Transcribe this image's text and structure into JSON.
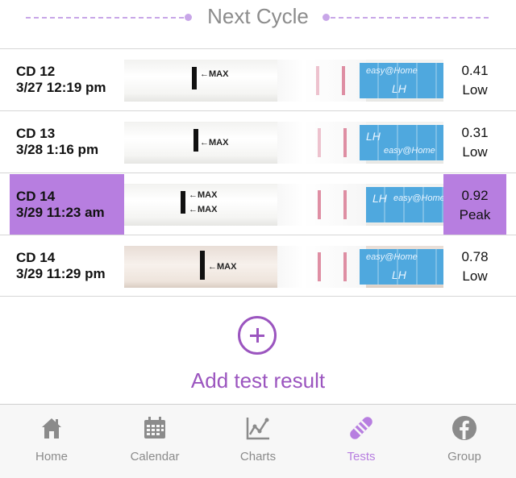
{
  "header": {
    "title": "Next Cycle"
  },
  "tests": [
    {
      "cd": "CD 12",
      "datetime": "3/27 12:19 pm",
      "value": "0.41",
      "level": "Low",
      "highlight": false
    },
    {
      "cd": "CD 13",
      "datetime": "3/28 1:16 pm",
      "value": "0.31",
      "level": "Low",
      "highlight": false
    },
    {
      "cd": "CD 14",
      "datetime": "3/29 11:23 am",
      "value": "0.92",
      "level": "Peak",
      "highlight": true
    },
    {
      "cd": "CD 14",
      "datetime": "3/29 11:29 pm",
      "value": "0.78",
      "level": "Low",
      "highlight": false
    }
  ],
  "strip_text": {
    "max": "←MAX",
    "brand": "easy@Home",
    "lh": "LH"
  },
  "add": {
    "label": "Add test result"
  },
  "tabs": [
    {
      "label": "Home",
      "icon": "home-icon",
      "active": false
    },
    {
      "label": "Calendar",
      "icon": "calendar-icon",
      "active": false
    },
    {
      "label": "Charts",
      "icon": "chart-icon",
      "active": false
    },
    {
      "label": "Tests",
      "icon": "test-strip-icon",
      "active": true
    },
    {
      "label": "Group",
      "icon": "facebook-icon",
      "active": false
    }
  ],
  "colors": {
    "accent": "#9b55bf",
    "highlight": "#b77ee0",
    "tab_inactive": "#8b8b8b",
    "divider": "#c8a6e8"
  }
}
